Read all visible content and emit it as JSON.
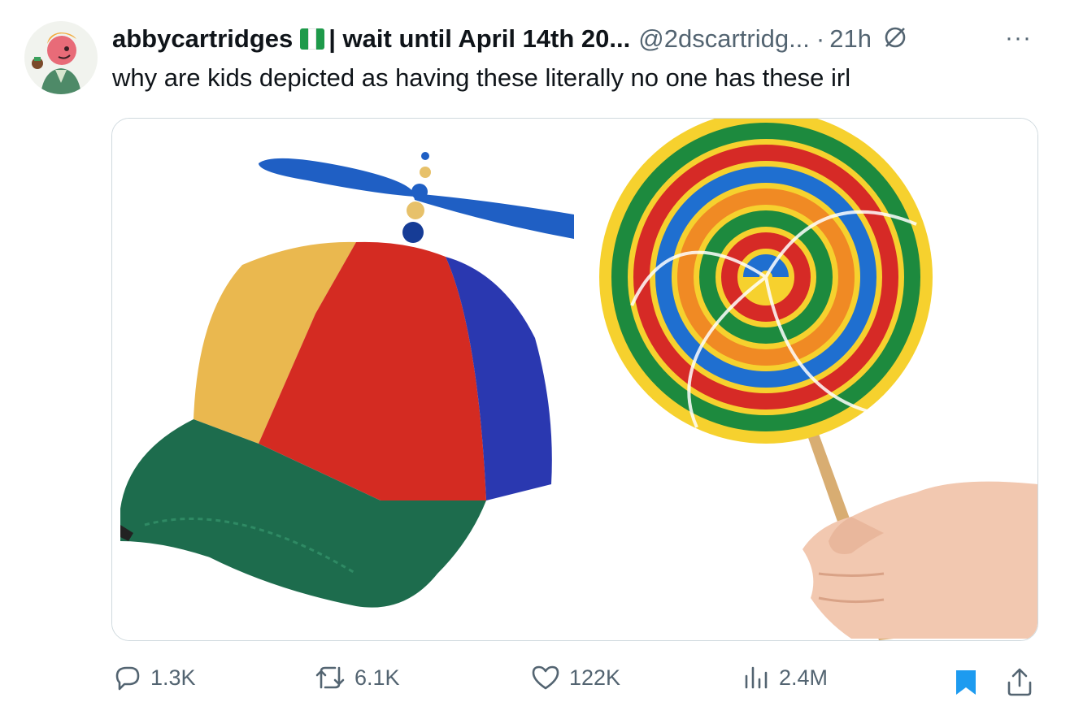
{
  "tweet": {
    "display_name": "abbycartridges",
    "name_suffix": "| wait until April 14th 20...",
    "handle": "@2dscartridg...",
    "separator": "·",
    "time": "21h",
    "more_label": "···",
    "text": "why are kids depicted as having these literally no one has these irl",
    "flag_colors": [
      "#1e9a4a",
      "#ffffff",
      "#1e9a4a"
    ]
  },
  "media": {
    "left_image_icon": "propeller-beanie-cap",
    "right_image_icon": "swirl-lollipop-in-hand"
  },
  "actions": {
    "replies": "1.3K",
    "retweets": "6.1K",
    "likes": "122K",
    "views": "2.4M"
  },
  "colors": {
    "bookmark_active": "#1d9bf0",
    "muted_text": "#536471"
  }
}
